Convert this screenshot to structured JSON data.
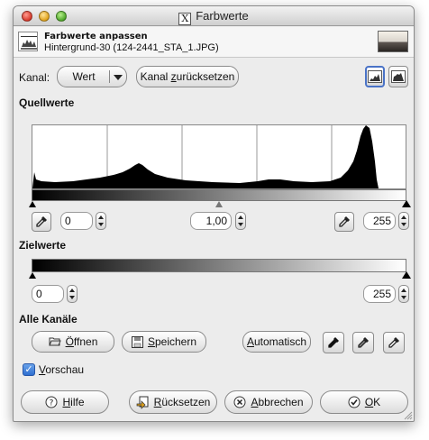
{
  "window": {
    "title": "Farbwerte"
  },
  "header": {
    "title": "Farbwerte anpassen",
    "subtitle": "Hintergrund-30 (124-2441_STA_1.JPG)"
  },
  "channel": {
    "label": "Kanal:",
    "value": "Wert",
    "reset_label_pre": "Kanal ",
    "reset_label_u": "z",
    "reset_label_post": "urücksetzen"
  },
  "input_levels": {
    "heading": "Quellwerte",
    "low": "0",
    "gamma": "1,00",
    "high": "255"
  },
  "output_levels": {
    "heading": "Zielwerte",
    "low": "0",
    "high": "255"
  },
  "all_channels": {
    "heading": "Alle Kanäle",
    "open": {
      "u": "Ö",
      "rest": "ffnen"
    },
    "save": {
      "u": "S",
      "rest": "peichern"
    },
    "auto": {
      "u": "A",
      "rest": "utomatisch"
    }
  },
  "preview": {
    "u": "V",
    "rest": "orschau",
    "checked": true
  },
  "buttons": {
    "help": {
      "u": "H",
      "rest": "ilfe"
    },
    "reset": {
      "u": "R",
      "rest": "ücksetzen"
    },
    "cancel": {
      "u": "A",
      "rest": "bbrechen"
    },
    "ok": {
      "u": "O",
      "rest": "K"
    }
  },
  "icons": {
    "close": "close-icon",
    "minimize": "minimize-icon",
    "zoom": "zoom-icon",
    "levels": "levels-icon",
    "linear": "linear-histogram-icon",
    "log": "log-histogram-icon",
    "eyedropper": "eyedropper-icon",
    "open": "folder-open-icon",
    "save": "save-icon",
    "help": "help-icon",
    "reset": "reset-icon",
    "cancel": "cancel-icon",
    "ok": "check-icon"
  }
}
